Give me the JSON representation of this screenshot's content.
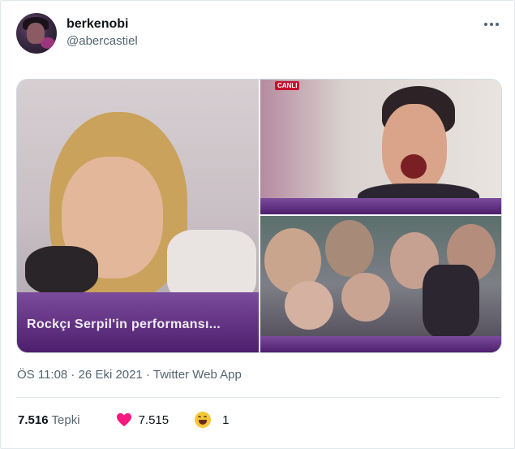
{
  "tweet": {
    "display_name": "berkenobi",
    "handle": "@abercastiel",
    "media_caption": "Rockçı Serpil'in performansı...",
    "channel_logo": "CANLI",
    "timestamp": "ÖS 11:08 · 26 Eki 2021 · Twitter Web App",
    "stats": {
      "reaction_total": "7.516",
      "reaction_label": "Tepki",
      "like_count": "7.515",
      "laugh_count": "1"
    }
  },
  "icons": {
    "more": "more-options-icon",
    "like": "heart-icon",
    "laugh": "laughing-face-icon"
  },
  "colors": {
    "heart": "#f91880",
    "secondary_text": "#536471",
    "tv_banner": "#5a2a7c"
  }
}
